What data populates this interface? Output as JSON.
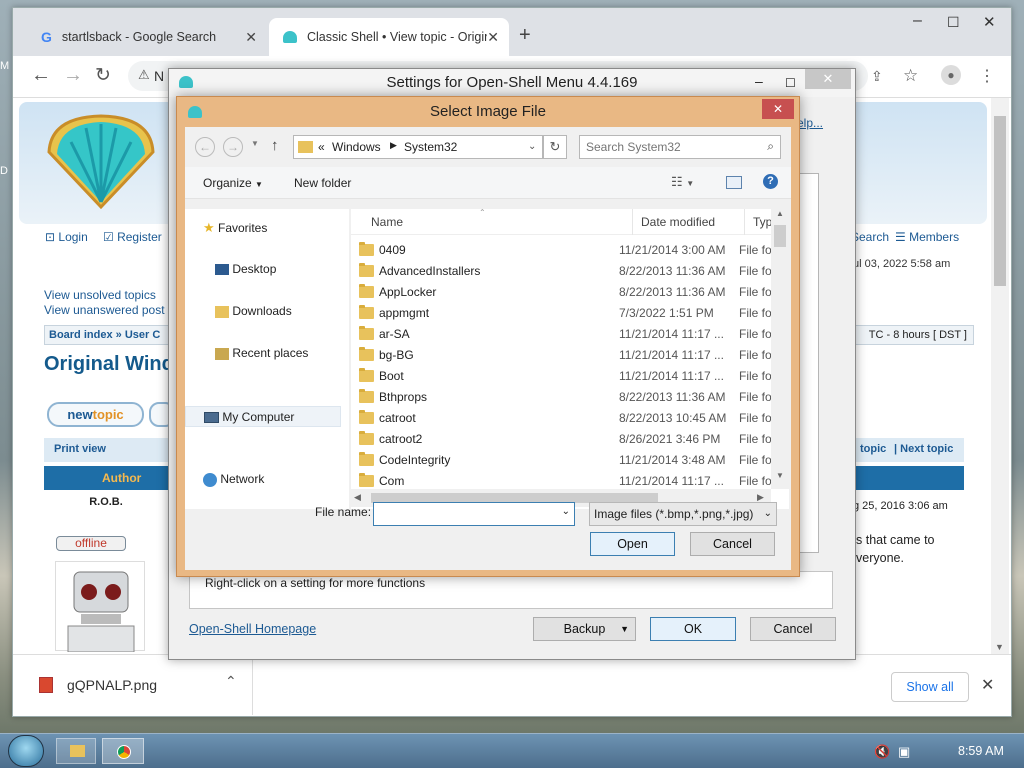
{
  "browser": {
    "tabs": [
      {
        "label": "startlsback - Google Search",
        "icon": "google-icon"
      },
      {
        "label": "Classic Shell • View topic - Origin",
        "icon": "shell-icon"
      }
    ],
    "address_start": "N",
    "window_buttons": [
      "–",
      "☐",
      "✕"
    ]
  },
  "forum": {
    "login": "Login",
    "register": "Register",
    "search": "Search",
    "members": "Members",
    "date_text": "ul 03, 2022 5:58 am",
    "view_unsolved": "View unsolved topics",
    "view_unanswered": "View unanswered post",
    "breadcrumb_board": "Board index",
    "breadcrumb_user": "User C",
    "timezone": "TC - 8 hours [ DST ]",
    "topic_title": "Original Wind",
    "newtopic_a": "new",
    "newtopic_b": "topic",
    "print_view": "Print view",
    "prev_topic": "topic",
    "next_topic": "Next topic",
    "author_header": "Author",
    "author_name": "R.O.B.",
    "post_date": "g 25, 2016 3:06 am",
    "offline": "offline",
    "post_line1": "s that came to",
    "post_line2": "veryone."
  },
  "download": {
    "filename": "gQPNALP.png",
    "show_all": "Show all"
  },
  "settings": {
    "title": "Settings for Open-Shell Menu 4.4.169",
    "hint": "Right-click on a setting for more functions",
    "homepage": "Open-Shell Homepage",
    "backup": "Backup",
    "ok": "OK",
    "cancel": "Cancel",
    "help": "elp..."
  },
  "image_dialog": {
    "title": "Select Image File",
    "path": [
      "«",
      "Windows",
      "System32"
    ],
    "search_placeholder": "Search System32",
    "organize": "Organize",
    "new_folder": "New folder",
    "nav": {
      "favorites": "Favorites",
      "desktop": "Desktop",
      "downloads": "Downloads",
      "recent": "Recent places",
      "computer": "My Computer",
      "network": "Network"
    },
    "columns": {
      "name": "Name",
      "date": "Date modified",
      "type": "Type"
    },
    "files": [
      {
        "name": "0409",
        "date": "11/21/2014 3:00 AM",
        "type": "File fol"
      },
      {
        "name": "AdvancedInstallers",
        "date": "8/22/2013 11:36 AM",
        "type": "File fol"
      },
      {
        "name": "AppLocker",
        "date": "8/22/2013 11:36 AM",
        "type": "File fol"
      },
      {
        "name": "appmgmt",
        "date": "7/3/2022 1:51 PM",
        "type": "File fol"
      },
      {
        "name": "ar-SA",
        "date": "11/21/2014 11:17 ...",
        "type": "File fol"
      },
      {
        "name": "bg-BG",
        "date": "11/21/2014 11:17 ...",
        "type": "File fol"
      },
      {
        "name": "Boot",
        "date": "11/21/2014 11:17 ...",
        "type": "File fol"
      },
      {
        "name": "Bthprops",
        "date": "8/22/2013 11:36 AM",
        "type": "File fol"
      },
      {
        "name": "catroot",
        "date": "8/22/2013 10:45 AM",
        "type": "File fol"
      },
      {
        "name": "catroot2",
        "date": "8/26/2021 3:46 PM",
        "type": "File fol"
      },
      {
        "name": "CodeIntegrity",
        "date": "11/21/2014 3:48 AM",
        "type": "File fol"
      },
      {
        "name": "Com",
        "date": "11/21/2014 11:17 ...",
        "type": "File fol"
      }
    ],
    "filename_label": "File name:",
    "filename_value": "",
    "filter": "Image files (*.bmp,*.png,*.jpg)",
    "open": "Open",
    "cancel": "Cancel"
  },
  "taskbar": {
    "time": "8:59 AM"
  }
}
